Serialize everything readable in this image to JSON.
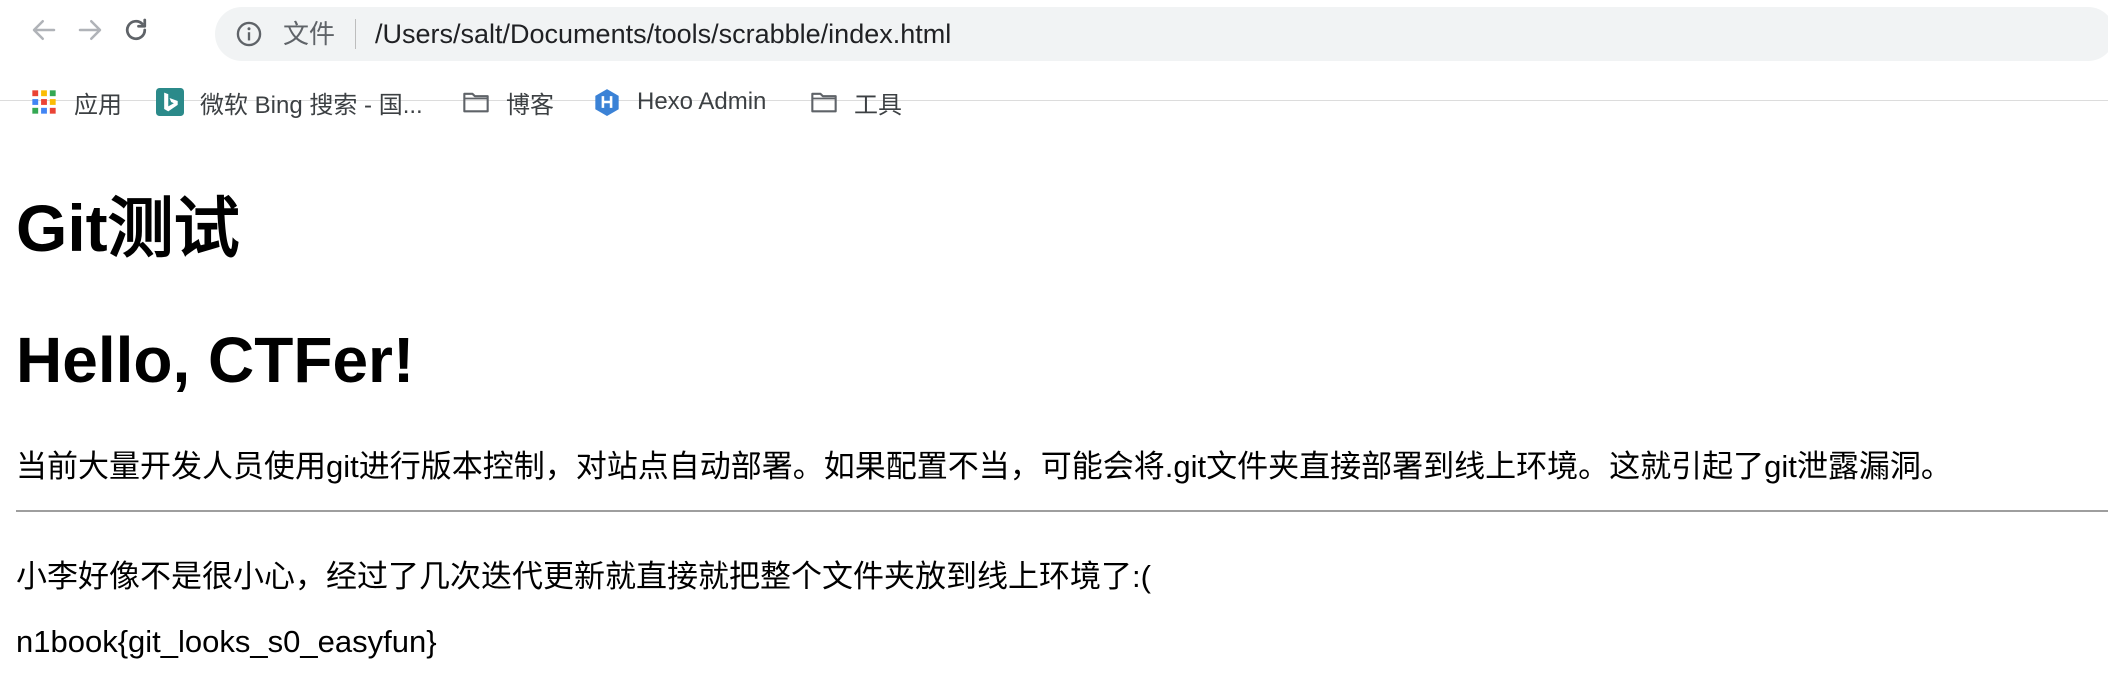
{
  "browser": {
    "scheme_label": "文件",
    "url": "/Users/salt/Documents/tools/scrabble/index.html",
    "bookmarks": [
      {
        "label": "应用",
        "icon": "apps-grid-icon"
      },
      {
        "label": "微软 Bing 搜索 - 国...",
        "icon": "bing-icon"
      },
      {
        "label": "博客",
        "icon": "folder-icon"
      },
      {
        "label": "Hexo Admin",
        "icon": "hexo-icon"
      },
      {
        "label": "工具",
        "icon": "folder-icon"
      }
    ],
    "colors": {
      "omnibox_bg": "#f1f3f4",
      "bing": "#2b8a8a",
      "hexo": "#3b82d6"
    }
  },
  "page": {
    "title": "Git测试",
    "greeting": "Hello, CTFer!",
    "intro": "当前大量开发人员使用git进行版本控制，对站点自动部署。如果配置不当，可能会将.git文件夹直接部署到线上环境。这就引起了git泄露漏洞。",
    "story": "小李好像不是很小心，经过了几次迭代更新就直接就把整个文件夹放到线上环境了:(",
    "flag": "n1book{git_looks_s0_easyfun}"
  }
}
